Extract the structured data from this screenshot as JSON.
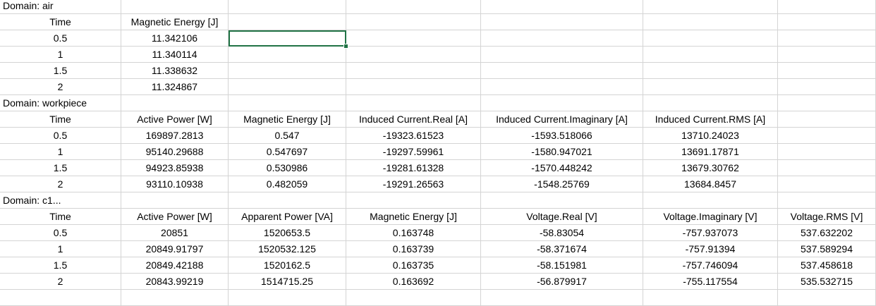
{
  "grid": {
    "rows": [
      [
        "Domain: air",
        "",
        "",
        "",
        "",
        "",
        ""
      ],
      [
        "Time",
        "Magnetic Energy [J]",
        "",
        "",
        "",
        "",
        ""
      ],
      [
        "0.5",
        "11.342106",
        "",
        "",
        "",
        "",
        ""
      ],
      [
        "1",
        "11.340114",
        "",
        "",
        "",
        "",
        ""
      ],
      [
        "1.5",
        "11.338632",
        "",
        "",
        "",
        "",
        ""
      ],
      [
        "2",
        "11.324867",
        "",
        "",
        "",
        "",
        ""
      ],
      [
        "Domain: workpiece",
        "",
        "",
        "",
        "",
        "",
        ""
      ],
      [
        "Time",
        "Active Power [W]",
        "Magnetic Energy [J]",
        "Induced Current.Real [A]",
        "Induced Current.Imaginary [A]",
        "Induced Current.RMS [A]",
        ""
      ],
      [
        "0.5",
        "169897.2813",
        "0.547",
        "-19323.61523",
        "-1593.518066",
        "13710.24023",
        ""
      ],
      [
        "1",
        "95140.29688",
        "0.547697",
        "-19297.59961",
        "-1580.947021",
        "13691.17871",
        ""
      ],
      [
        "1.5",
        "94923.85938",
        "0.530986",
        "-19281.61328",
        "-1570.448242",
        "13679.30762",
        ""
      ],
      [
        "2",
        "93110.10938",
        "0.482059",
        "-19291.26563",
        "-1548.25769",
        "13684.8457",
        ""
      ],
      [
        "Domain: c1...",
        "",
        "",
        "",
        "",
        "",
        ""
      ],
      [
        "Time",
        "Active Power [W]",
        "Apparent Power [VA]",
        "Magnetic Energy [J]",
        "Voltage.Real [V]",
        "Voltage.Imaginary [V]",
        "Voltage.RMS [V]"
      ],
      [
        "0.5",
        "20851",
        "1520653.5",
        "0.163748",
        "-58.83054",
        "-757.937073",
        "537.632202"
      ],
      [
        "1",
        "20849.91797",
        "1520532.125",
        "0.163739",
        "-58.371674",
        "-757.91394",
        "537.589294"
      ],
      [
        "1.5",
        "20849.42188",
        "1520162.5",
        "0.163735",
        "-58.151981",
        "-757.746094",
        "537.458618"
      ],
      [
        "2",
        "20843.99219",
        "1514715.25",
        "0.163692",
        "-56.879917",
        "-755.117554",
        "535.532715"
      ],
      [
        "",
        "",
        "",
        "",
        "",
        "",
        ""
      ]
    ],
    "selected_cell": {
      "row": 2,
      "col": 2
    },
    "selection_color": "#217346",
    "gridline_color": "#d4d4d4"
  }
}
